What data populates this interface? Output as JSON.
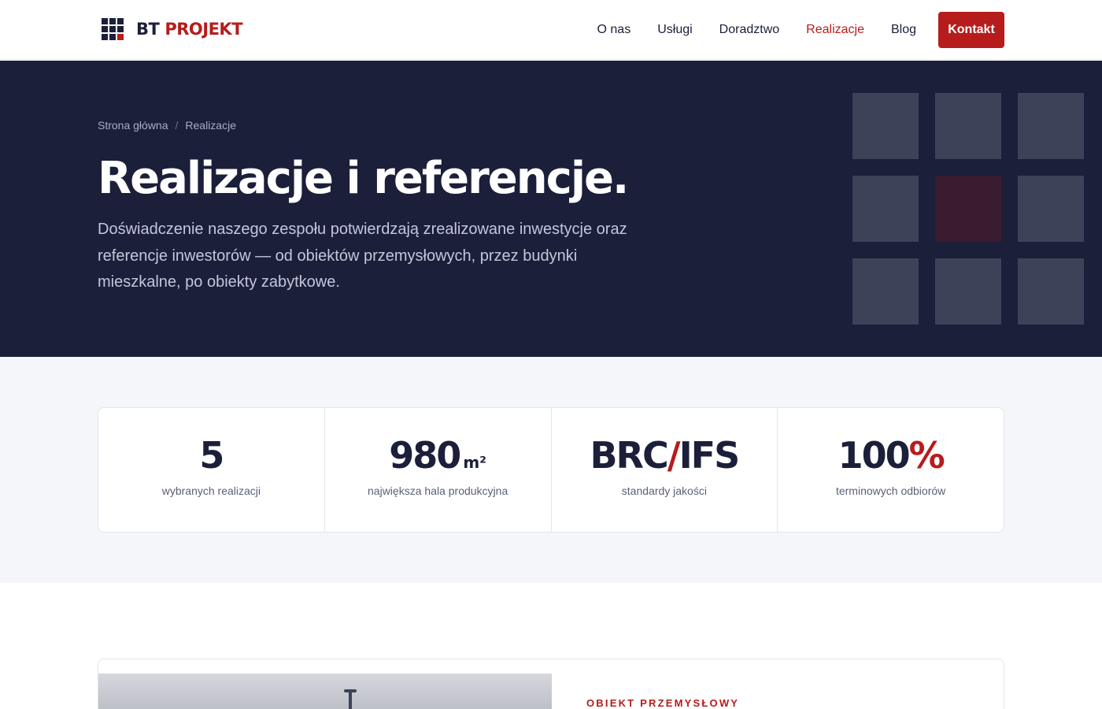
{
  "header": {
    "logo": {
      "part1": "BT",
      "part2": "PROJEKT"
    },
    "nav": [
      {
        "label": "O nas"
      },
      {
        "label": "Usługi"
      },
      {
        "label": "Doradztwo"
      },
      {
        "label": "Realizacje",
        "active": true
      },
      {
        "label": "Blog"
      }
    ],
    "cta_label": "Kontakt"
  },
  "hero": {
    "breadcrumb": {
      "home": "Strona główna",
      "separator": "/",
      "current": "Realizacje"
    },
    "title": "Realizacje i referencje.",
    "description": "Doświadczenie naszego zespołu potwierdzają zrealizowane inwestycje oraz referencje inwestorów — od obiektów przemysłowych, przez budynki mieszkalne, po obiekty zabytkowe."
  },
  "stats": [
    {
      "value": "5",
      "unit": "",
      "label": "wybranych realizacji"
    },
    {
      "value": "980",
      "unit": "m²",
      "label": "największa hala produkcyjna"
    },
    {
      "value_a": "BRC",
      "value_sep": "/",
      "value_b": "IFS",
      "label": "standardy jakości"
    },
    {
      "value": "100",
      "accent": "%",
      "label": "terminowych odbiorów"
    }
  ],
  "project_card": {
    "category": "OBIEKT PRZEMYSŁOWY"
  },
  "colors": {
    "navy": "#1b1f3a",
    "accent_red": "#b71c1c",
    "hero_square": "#3d4259",
    "hero_square_accent": "#3a1c31",
    "stats_bg": "#f4f6fa"
  },
  "icons": {
    "logo": "grid-logo-icon"
  }
}
